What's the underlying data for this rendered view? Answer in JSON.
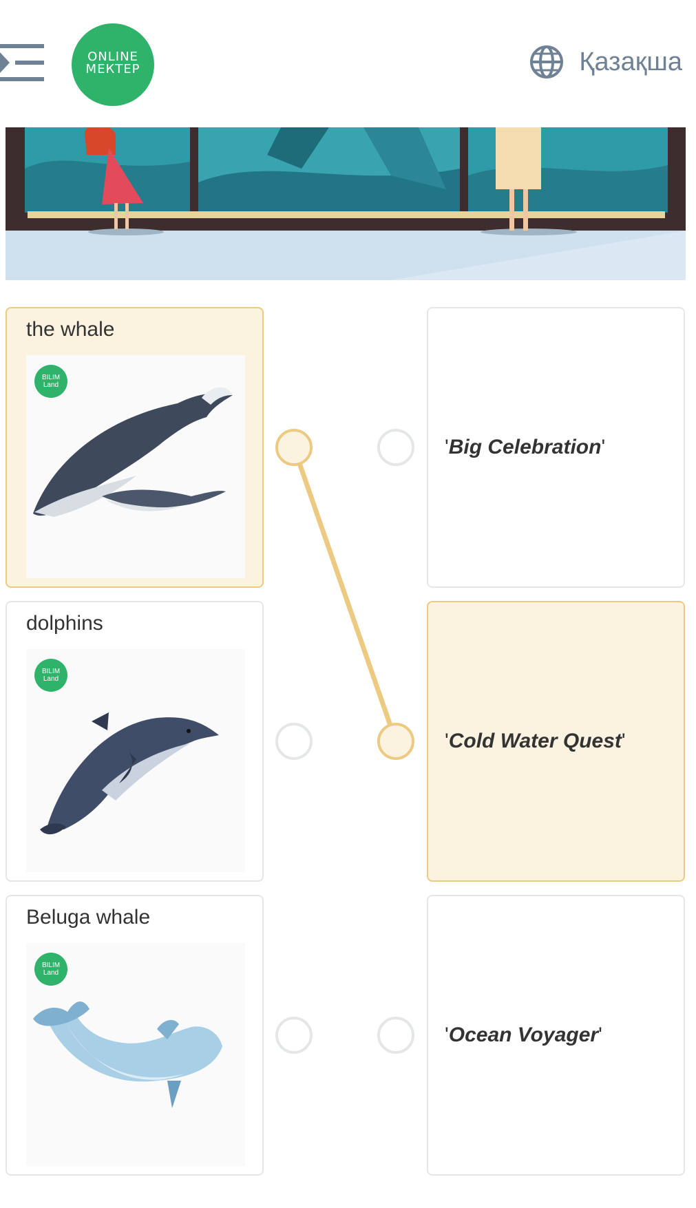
{
  "header": {
    "menu_icon": "menu-toggle-icon",
    "logo_line1": "ONLINE",
    "logo_line2": "МЕКТЕР",
    "logo_color": "#2fb36a",
    "language": "Қазақша",
    "language_icon": "globe-icon"
  },
  "left_items": [
    {
      "title": "the whale",
      "badge": "BILIM Land",
      "image": "humpback-whales",
      "selected": true
    },
    {
      "title": "dolphins",
      "badge": "BILIM Land",
      "image": "dolphin",
      "selected": false
    },
    {
      "title": "Beluga whale",
      "badge": "BILIM Land",
      "image": "beluga-whale",
      "selected": false
    }
  ],
  "right_items": [
    {
      "label": "Big Celebration",
      "selected": false
    },
    {
      "label": "Cold Water Quest",
      "selected": true
    },
    {
      "label": "Ocean Voyager",
      "selected": false
    }
  ],
  "connections": [
    {
      "from": "the whale",
      "to": "Cold Water Quest"
    }
  ],
  "colors": {
    "accent": "#ecca82",
    "selected_bg": "#fbf2e0",
    "border": "#e6e6e6",
    "brand_green": "#2fb36a"
  }
}
